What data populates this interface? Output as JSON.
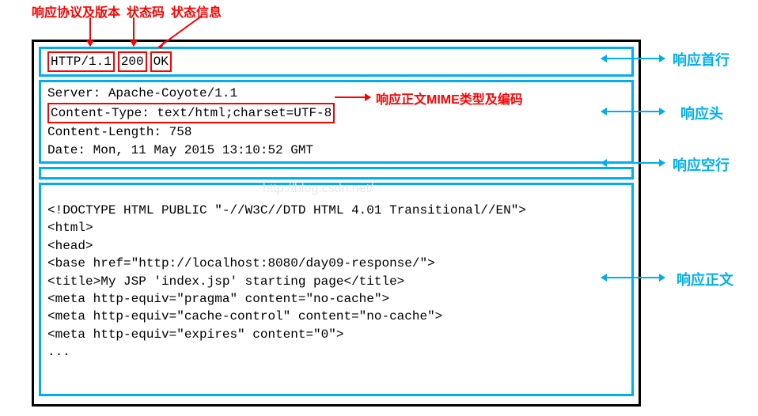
{
  "topLabels": {
    "protocol": "响应协议及版本",
    "status_code": "状态码",
    "status_msg": "状态信息"
  },
  "statusLine": {
    "protocol": "HTTP/1.1",
    "code": "200",
    "msg": "OK"
  },
  "headers": {
    "server": "Server: Apache-Coyote/1.1",
    "content_type": "Content-Type: text/html;charset=UTF-8",
    "content_length": "Content-Length: 758",
    "date": "Date: Mon, 11 May 2015 13:10:52 GMT"
  },
  "mime_annotation": "响应正文MIME类型及编码",
  "body_lines": [
    "<!DOCTYPE HTML PUBLIC \"-//W3C//DTD HTML 4.01 Transitional//EN\">",
    "<html>",
    "  <head>",
    "    <base href=\"http://localhost:8080/day09-response/\">",
    "    ",
    "    <title>My JSP 'index.jsp' starting page</title>",
    "<meta http-equiv=\"pragma\" content=\"no-cache\">",
    "<meta http-equiv=\"cache-control\" content=\"no-cache\">",
    "<meta http-equiv=\"expires\" content=\"0\">",
    "..."
  ],
  "rightLabels": {
    "status_line": "响应首行",
    "headers": "响应头",
    "empty_line": "响应空行",
    "body": "响应正文"
  },
  "watermark": "http://blog.csdn.net/"
}
